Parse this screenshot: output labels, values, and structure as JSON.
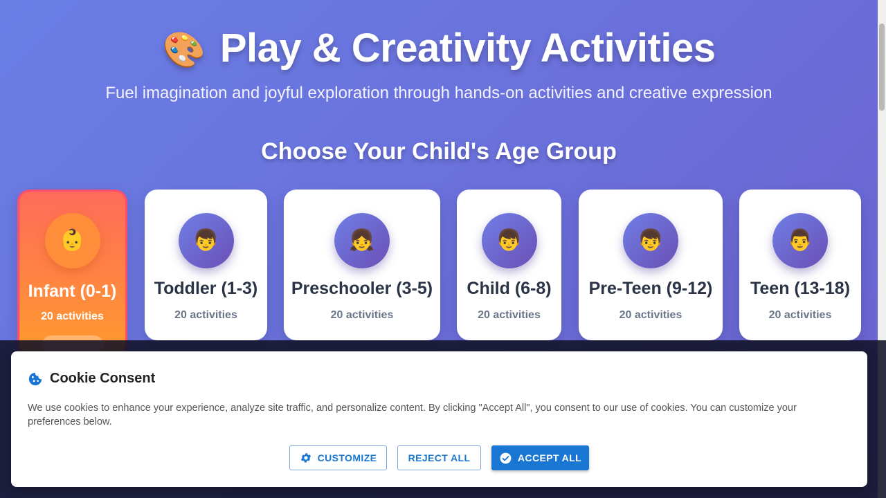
{
  "hero": {
    "title_icon": "🎨",
    "title": "Play & Creativity Activities",
    "subtitle": "Fuel imagination and joyful exploration through hands-on activities and creative expression"
  },
  "age_section": {
    "title": "Choose Your Child's Age Group",
    "groups": [
      {
        "emoji": "👶",
        "label": "Infant (0-1)",
        "count": "20 activities",
        "active": true
      },
      {
        "emoji": "👦",
        "label": "Toddler (1-3)",
        "count": "20 activities",
        "active": false
      },
      {
        "emoji": "👧",
        "label": "Preschooler (3-5)",
        "count": "20 activities",
        "active": false
      },
      {
        "emoji": "👦",
        "label": "Child (6-8)",
        "count": "20 activities",
        "active": false
      },
      {
        "emoji": "👦",
        "label": "Pre-Teen (9-12)",
        "count": "20 activities",
        "active": false
      },
      {
        "emoji": "👨",
        "label": "Teen (13-18)",
        "count": "20 activities",
        "active": false
      }
    ]
  },
  "cookie": {
    "title": "Cookie Consent",
    "text": "We use cookies to enhance your experience, analyze site traffic, and personalize content. By clicking \"Accept All\", you consent to our use of cookies. You can customize your preferences below.",
    "customize_label": "CUSTOMIZE",
    "reject_label": "REJECT ALL",
    "accept_label": "ACCEPT ALL"
  },
  "colors": {
    "accent": "#1976d2",
    "active_card_start": "#ff6b5a",
    "active_card_end": "#ff9a2e"
  }
}
